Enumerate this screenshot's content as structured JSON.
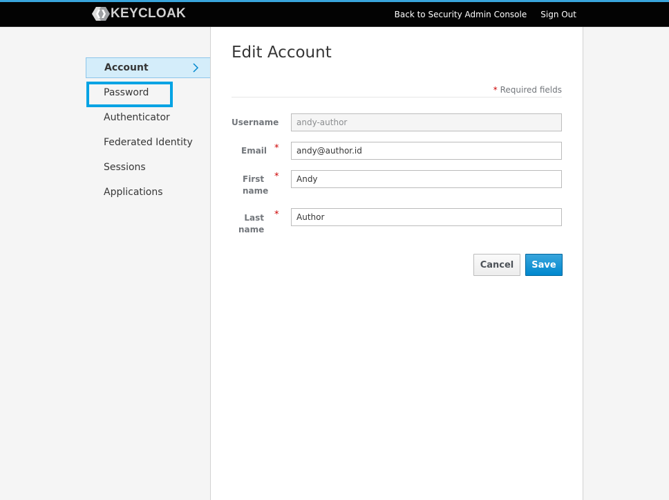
{
  "header": {
    "logo_text": "KEYCLOAK",
    "links": {
      "back_to_admin": "Back to Security Admin Console",
      "sign_out": "Sign Out"
    }
  },
  "sidebar": {
    "items": [
      {
        "label": "Account",
        "active": true
      },
      {
        "label": "Password",
        "active": false
      },
      {
        "label": "Authenticator",
        "active": false
      },
      {
        "label": "Federated Identity",
        "active": false
      },
      {
        "label": "Sessions",
        "active": false
      },
      {
        "label": "Applications",
        "active": false
      }
    ]
  },
  "main": {
    "title": "Edit Account",
    "required_star": "*",
    "required_text": "Required fields",
    "fields": {
      "username": {
        "label": "Username",
        "value": "andy-author",
        "readonly": true
      },
      "email": {
        "label": "Email",
        "value": "andy@author.id",
        "required": true
      },
      "first_name": {
        "label_line1": "First",
        "label_line2": "name",
        "value": "Andy",
        "required": true
      },
      "last_name": {
        "label_line1": "Last",
        "label_line2": "name",
        "value": "Author",
        "required": true
      }
    },
    "buttons": {
      "cancel": "Cancel",
      "save": "Save"
    }
  },
  "colors": {
    "header_bg": "#030303",
    "header_accent": "#39a5dc",
    "active_nav_bg": "#d4edfa",
    "highlight_box": "#00a3e4",
    "required_star": "#cc0000",
    "save_button": "#0088ce"
  },
  "icons": {
    "logo": "keycloak-logo-icon",
    "active_chevron": "chevron-right-icon"
  }
}
